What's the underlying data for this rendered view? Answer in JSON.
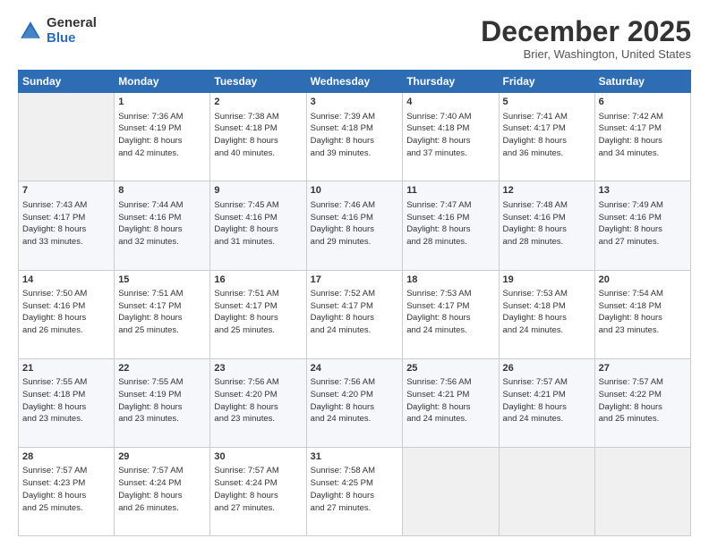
{
  "logo": {
    "general": "General",
    "blue": "Blue",
    "icon": "▶"
  },
  "title": "December 2025",
  "subtitle": "Brier, Washington, United States",
  "headers": [
    "Sunday",
    "Monday",
    "Tuesday",
    "Wednesday",
    "Thursday",
    "Friday",
    "Saturday"
  ],
  "weeks": [
    [
      {
        "day": "",
        "info": ""
      },
      {
        "day": "1",
        "info": "Sunrise: 7:36 AM\nSunset: 4:19 PM\nDaylight: 8 hours\nand 42 minutes."
      },
      {
        "day": "2",
        "info": "Sunrise: 7:38 AM\nSunset: 4:18 PM\nDaylight: 8 hours\nand 40 minutes."
      },
      {
        "day": "3",
        "info": "Sunrise: 7:39 AM\nSunset: 4:18 PM\nDaylight: 8 hours\nand 39 minutes."
      },
      {
        "day": "4",
        "info": "Sunrise: 7:40 AM\nSunset: 4:18 PM\nDaylight: 8 hours\nand 37 minutes."
      },
      {
        "day": "5",
        "info": "Sunrise: 7:41 AM\nSunset: 4:17 PM\nDaylight: 8 hours\nand 36 minutes."
      },
      {
        "day": "6",
        "info": "Sunrise: 7:42 AM\nSunset: 4:17 PM\nDaylight: 8 hours\nand 34 minutes."
      }
    ],
    [
      {
        "day": "7",
        "info": "Sunrise: 7:43 AM\nSunset: 4:17 PM\nDaylight: 8 hours\nand 33 minutes."
      },
      {
        "day": "8",
        "info": "Sunrise: 7:44 AM\nSunset: 4:16 PM\nDaylight: 8 hours\nand 32 minutes."
      },
      {
        "day": "9",
        "info": "Sunrise: 7:45 AM\nSunset: 4:16 PM\nDaylight: 8 hours\nand 31 minutes."
      },
      {
        "day": "10",
        "info": "Sunrise: 7:46 AM\nSunset: 4:16 PM\nDaylight: 8 hours\nand 29 minutes."
      },
      {
        "day": "11",
        "info": "Sunrise: 7:47 AM\nSunset: 4:16 PM\nDaylight: 8 hours\nand 28 minutes."
      },
      {
        "day": "12",
        "info": "Sunrise: 7:48 AM\nSunset: 4:16 PM\nDaylight: 8 hours\nand 28 minutes."
      },
      {
        "day": "13",
        "info": "Sunrise: 7:49 AM\nSunset: 4:16 PM\nDaylight: 8 hours\nand 27 minutes."
      }
    ],
    [
      {
        "day": "14",
        "info": "Sunrise: 7:50 AM\nSunset: 4:16 PM\nDaylight: 8 hours\nand 26 minutes."
      },
      {
        "day": "15",
        "info": "Sunrise: 7:51 AM\nSunset: 4:17 PM\nDaylight: 8 hours\nand 25 minutes."
      },
      {
        "day": "16",
        "info": "Sunrise: 7:51 AM\nSunset: 4:17 PM\nDaylight: 8 hours\nand 25 minutes."
      },
      {
        "day": "17",
        "info": "Sunrise: 7:52 AM\nSunset: 4:17 PM\nDaylight: 8 hours\nand 24 minutes."
      },
      {
        "day": "18",
        "info": "Sunrise: 7:53 AM\nSunset: 4:17 PM\nDaylight: 8 hours\nand 24 minutes."
      },
      {
        "day": "19",
        "info": "Sunrise: 7:53 AM\nSunset: 4:18 PM\nDaylight: 8 hours\nand 24 minutes."
      },
      {
        "day": "20",
        "info": "Sunrise: 7:54 AM\nSunset: 4:18 PM\nDaylight: 8 hours\nand 23 minutes."
      }
    ],
    [
      {
        "day": "21",
        "info": "Sunrise: 7:55 AM\nSunset: 4:18 PM\nDaylight: 8 hours\nand 23 minutes."
      },
      {
        "day": "22",
        "info": "Sunrise: 7:55 AM\nSunset: 4:19 PM\nDaylight: 8 hours\nand 23 minutes."
      },
      {
        "day": "23",
        "info": "Sunrise: 7:56 AM\nSunset: 4:20 PM\nDaylight: 8 hours\nand 23 minutes."
      },
      {
        "day": "24",
        "info": "Sunrise: 7:56 AM\nSunset: 4:20 PM\nDaylight: 8 hours\nand 24 minutes."
      },
      {
        "day": "25",
        "info": "Sunrise: 7:56 AM\nSunset: 4:21 PM\nDaylight: 8 hours\nand 24 minutes."
      },
      {
        "day": "26",
        "info": "Sunrise: 7:57 AM\nSunset: 4:21 PM\nDaylight: 8 hours\nand 24 minutes."
      },
      {
        "day": "27",
        "info": "Sunrise: 7:57 AM\nSunset: 4:22 PM\nDaylight: 8 hours\nand 25 minutes."
      }
    ],
    [
      {
        "day": "28",
        "info": "Sunrise: 7:57 AM\nSunset: 4:23 PM\nDaylight: 8 hours\nand 25 minutes."
      },
      {
        "day": "29",
        "info": "Sunrise: 7:57 AM\nSunset: 4:24 PM\nDaylight: 8 hours\nand 26 minutes."
      },
      {
        "day": "30",
        "info": "Sunrise: 7:57 AM\nSunset: 4:24 PM\nDaylight: 8 hours\nand 27 minutes."
      },
      {
        "day": "31",
        "info": "Sunrise: 7:58 AM\nSunset: 4:25 PM\nDaylight: 8 hours\nand 27 minutes."
      },
      {
        "day": "",
        "info": ""
      },
      {
        "day": "",
        "info": ""
      },
      {
        "day": "",
        "info": ""
      }
    ]
  ]
}
